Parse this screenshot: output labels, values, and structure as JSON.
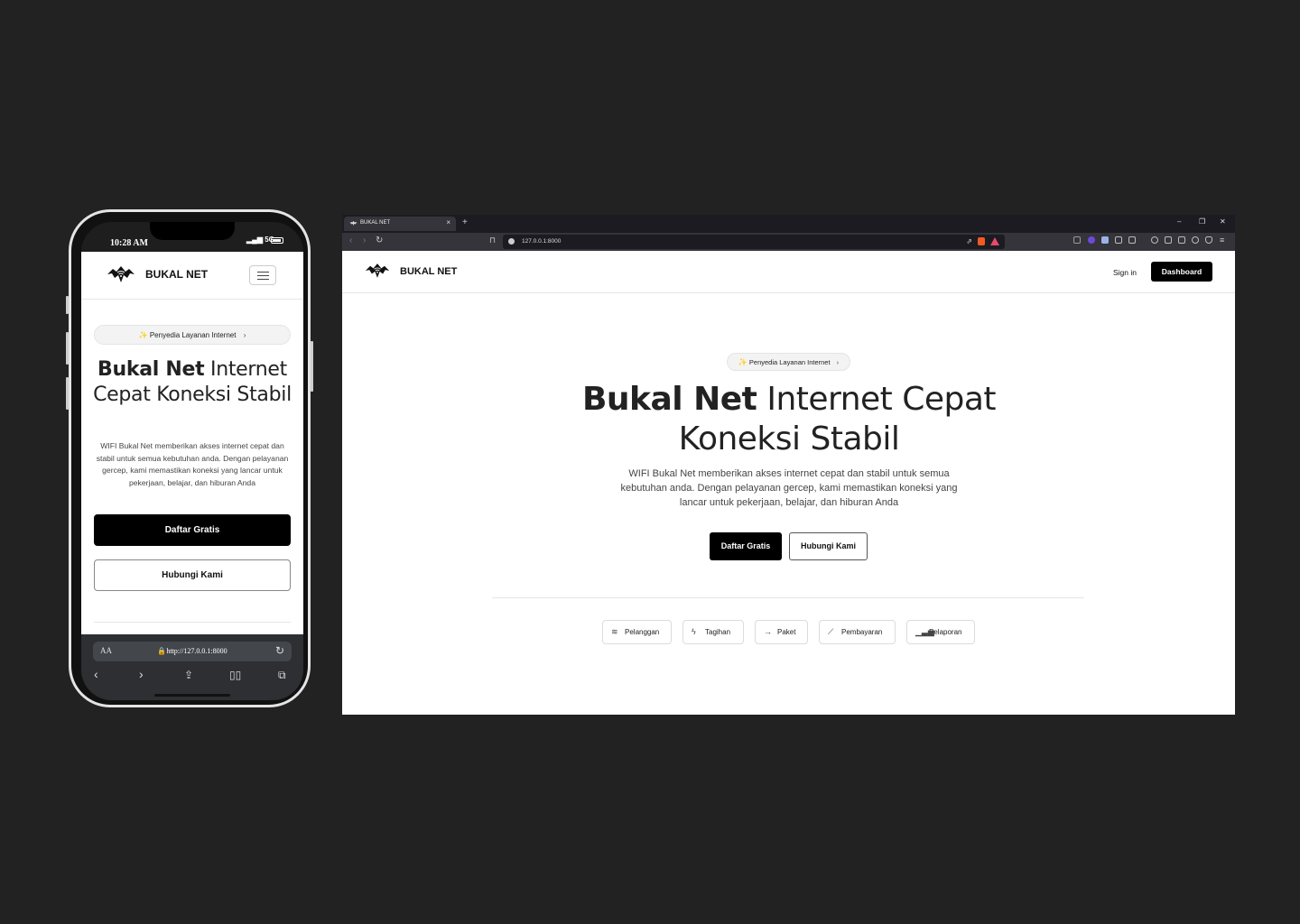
{
  "mobile": {
    "status_time": "10:28 AM",
    "status_signal": "5G",
    "brand": "BUKAL NET",
    "badge": "Penyedia Layanan Internet",
    "headline_bold": "Bukal Net",
    "headline_rest": "Internet Cepat Koneksi Stabil",
    "description": "WIFI Bukal Net memberikan akses internet cepat dan stabil untuk semua kebutuhan anda. Dengan pelayanan gercep, kami memastikan koneksi yang lancar untuk pekerjaan, belajar, dan hiburan Anda",
    "primary_cta": "Daftar Gratis",
    "secondary_cta": "Hubungi Kami",
    "safari": {
      "aa_label": "AA",
      "url": "http://127.0.0.1:8000"
    }
  },
  "desktop": {
    "tab_title": "BUKAL NET",
    "url": "127.0.0.1:8000",
    "brand": "BUKAL NET",
    "nav_signin": "Sign in",
    "nav_dashboard": "Dashboard",
    "badge": "Penyedia Layanan Internet",
    "headline_bold": "Bukal Net",
    "headline_rest": "Internet Cepat Koneksi Stabil",
    "description": "WIFI Bukal Net memberikan akses internet cepat dan stabil untuk semua kebutuhan anda. Dengan pelayanan gercep, kami memastikan koneksi yang lancar untuk pekerjaan, belajar, dan hiburan Anda",
    "primary_cta": "Daftar Gratis",
    "secondary_cta": "Hubungi Kami",
    "features": [
      {
        "label": "Pelanggan",
        "icon": "database-icon"
      },
      {
        "label": "Tagihan",
        "icon": "lightning-icon"
      },
      {
        "label": "Paket",
        "icon": "arrow-right-icon"
      },
      {
        "label": "Pembayaran",
        "icon": "line-chart-icon"
      },
      {
        "label": "Pelaporan",
        "icon": "bar-chart-icon"
      }
    ]
  },
  "colors": {
    "background": "#222222",
    "primary_button": "#000000",
    "text_dark": "#222222"
  }
}
